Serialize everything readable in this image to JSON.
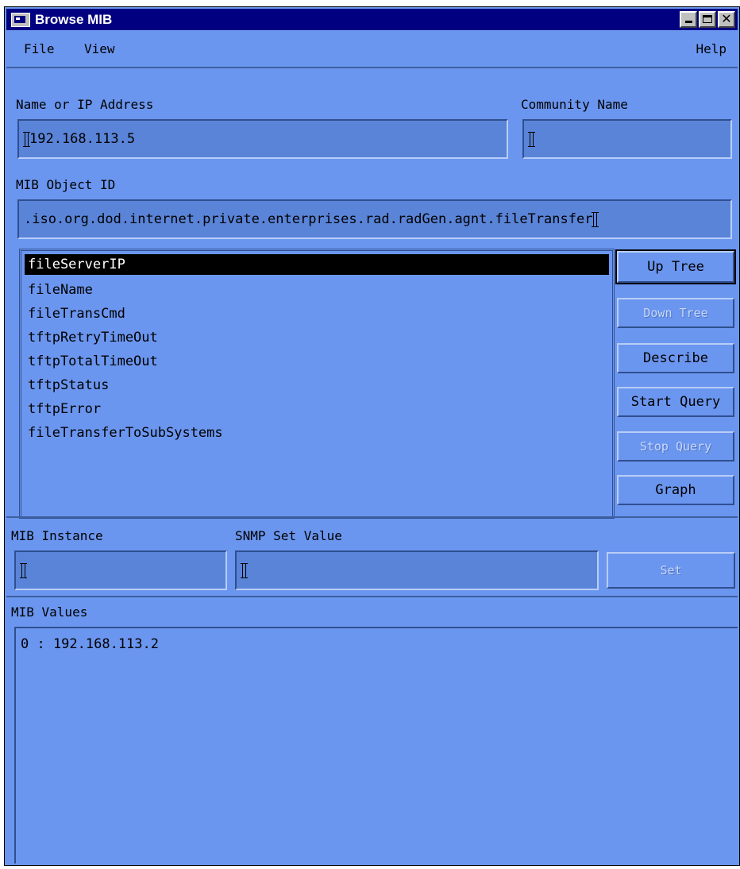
{
  "window": {
    "title": "Browse MIB"
  },
  "menu": {
    "file": "File",
    "view": "View",
    "help": "Help"
  },
  "host": {
    "label": "Name or IP Address",
    "value": "192.168.113.5"
  },
  "community": {
    "label": "Community Name",
    "value": ""
  },
  "oid": {
    "label": "MIB Object ID",
    "value": ".iso.org.dod.internet.private.enterprises.rad.radGen.agnt.fileTransfer"
  },
  "mib_list": {
    "items": [
      "fileServerIP",
      "fileName",
      "fileTransCmd",
      "tftpRetryTimeOut",
      "tftpTotalTimeOut",
      "tftpStatus",
      "tftpError",
      "fileTransferToSubSystems"
    ],
    "selected": "fileServerIP"
  },
  "buttons": {
    "up_tree": "Up Tree",
    "down_tree": "Down Tree",
    "describe": "Describe",
    "start_query": "Start Query",
    "stop_query": "Stop Query",
    "graph": "Graph",
    "set": "Set"
  },
  "instance": {
    "label": "MIB Instance",
    "value": ""
  },
  "set_value": {
    "label": "SNMP Set Value",
    "value": ""
  },
  "values": {
    "label": "MIB Values",
    "lines": [
      "0 : 192.168.113.2"
    ]
  },
  "colors": {
    "background": "#6b96ef",
    "titlebar": "#000080",
    "selection": "#000000"
  }
}
